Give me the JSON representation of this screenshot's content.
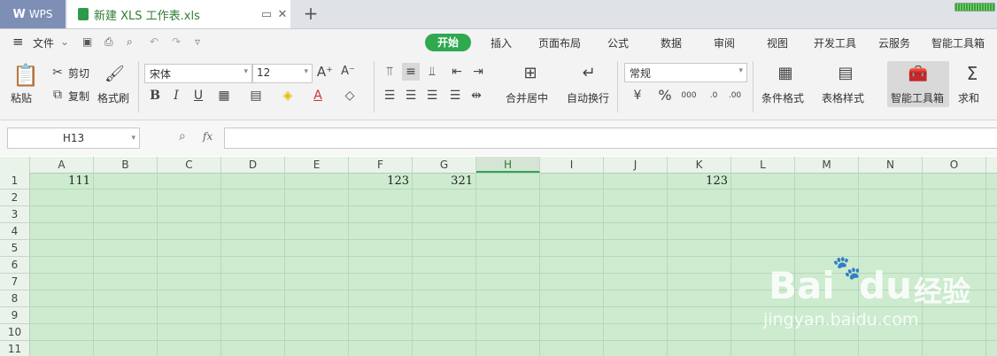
{
  "titlebar": {
    "app_tab": "WPS",
    "doc_tab": "新建 XLS 工作表.xls",
    "new_tab": "+"
  },
  "menu": {
    "file": "文件",
    "tabs": [
      "开始",
      "插入",
      "页面布局",
      "公式",
      "数据",
      "审阅",
      "视图",
      "开发工具",
      "云服务",
      "智能工具箱"
    ]
  },
  "ribbon": {
    "paste": "粘贴",
    "cut": "剪切",
    "copy": "复制",
    "format_painter": "格式刷",
    "font_name": "宋体",
    "font_size": "12",
    "merge_center": "合并居中",
    "auto_wrap": "自动换行",
    "number_format": "常规",
    "cond_format": "条件格式",
    "table_style": "表格样式",
    "smart_toolbox": "智能工具箱",
    "sum": "求和",
    "bold": "B",
    "italic": "I",
    "underline": "U",
    "percent": "%",
    "thousands": "000"
  },
  "formula_bar": {
    "name_box": "H13",
    "fx": "fx",
    "value": ""
  },
  "sheet": {
    "columns": [
      "A",
      "B",
      "C",
      "D",
      "E",
      "F",
      "G",
      "H",
      "I",
      "J",
      "K",
      "L",
      "M",
      "N",
      "O"
    ],
    "selected_column": "H",
    "rows": [
      "1",
      "2",
      "3",
      "4",
      "5",
      "6",
      "7",
      "8",
      "9",
      "10",
      "11"
    ],
    "cells": {
      "A1": "111",
      "F1": "123",
      "G1": "321",
      "K1": "123"
    }
  },
  "watermark": {
    "brand": "Bai",
    "brand2": "du",
    "cn": "经验",
    "url": "jingyan.baidu.com"
  },
  "colors": {
    "accent": "#2fa84f",
    "sheet_bg": "#ccebcf"
  }
}
